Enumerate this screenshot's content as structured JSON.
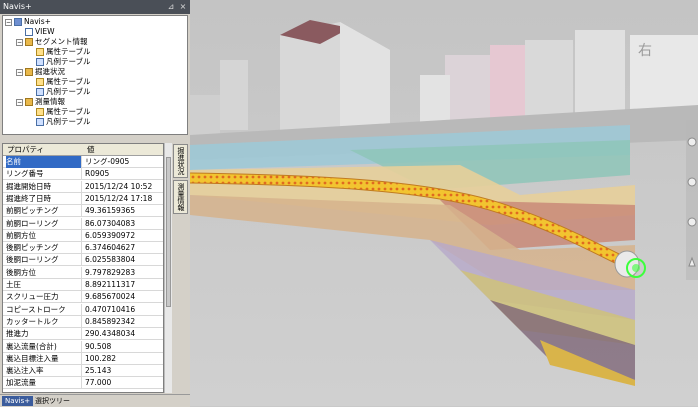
{
  "panel": {
    "title": "Navis+",
    "pin_icon": "pin-icon",
    "close_icon": "close-icon"
  },
  "tree": {
    "root": "Navis+",
    "items": [
      {
        "label": "VIEW",
        "level": 1,
        "icon": "view-icon"
      },
      {
        "label": "セグメント情報",
        "level": 1,
        "icon": "folder-icon"
      },
      {
        "label": "属性テーブル",
        "level": 2,
        "icon": "table-icon"
      },
      {
        "label": "凡例テーブル",
        "level": 2,
        "icon": "legend-icon"
      },
      {
        "label": "掘進状況",
        "level": 1,
        "icon": "folder-icon"
      },
      {
        "label": "属性テーブル",
        "level": 2,
        "icon": "table-icon"
      },
      {
        "label": "凡例テーブル",
        "level": 2,
        "icon": "legend-icon"
      },
      {
        "label": "測量情報",
        "level": 1,
        "icon": "folder-icon"
      },
      {
        "label": "属性テーブル",
        "level": 2,
        "icon": "table-icon"
      },
      {
        "label": "凡例テーブル",
        "level": 2,
        "icon": "legend-icon"
      }
    ]
  },
  "grid": {
    "col_property": "プロパティ",
    "col_value": "値",
    "rows": [
      {
        "p": "名前",
        "v": "リング-0905"
      },
      {
        "p": "リング番号",
        "v": "R0905"
      },
      {
        "p": "掘進開始日時",
        "v": "2015/12/24 10:52"
      },
      {
        "p": "掘進終了日時",
        "v": "2015/12/24 17:18"
      },
      {
        "p": "前胴ピッチング",
        "v": "49.36159365"
      },
      {
        "p": "前胴ローリング",
        "v": "86.07304083"
      },
      {
        "p": "前胴方位",
        "v": "6.059390972"
      },
      {
        "p": "後胴ピッチング",
        "v": "6.374604627"
      },
      {
        "p": "後胴ローリング",
        "v": "6.025583804"
      },
      {
        "p": "後胴方位",
        "v": "9.797829283"
      },
      {
        "p": "土圧",
        "v": "8.892111317"
      },
      {
        "p": "スクリュー圧力",
        "v": "9.685670024"
      },
      {
        "p": "コピーストローク",
        "v": "0.470710416"
      },
      {
        "p": "カッタートルク",
        "v": "0.845892342"
      },
      {
        "p": "推進力",
        "v": "290.4348034"
      },
      {
        "p": "裏込流量(合計)",
        "v": "90.508"
      },
      {
        "p": "裏込目標注入量",
        "v": "100.282"
      },
      {
        "p": "裏込注入率",
        "v": "25.143"
      },
      {
        "p": "加泥流量",
        "v": "77.000"
      }
    ]
  },
  "side_tabs": [
    "掘進状況",
    "測量情報"
  ],
  "bottom_tabs": [
    "Navis+",
    "選択ツリー"
  ],
  "viewport": {
    "sign_text": "右"
  },
  "colors": {
    "title_bg": "#4a4f57",
    "selection": "#316ac5",
    "tunnel": "#f2c430",
    "tunnel_dots": "#e06a20",
    "ring_highlight": "#3cff3c"
  }
}
